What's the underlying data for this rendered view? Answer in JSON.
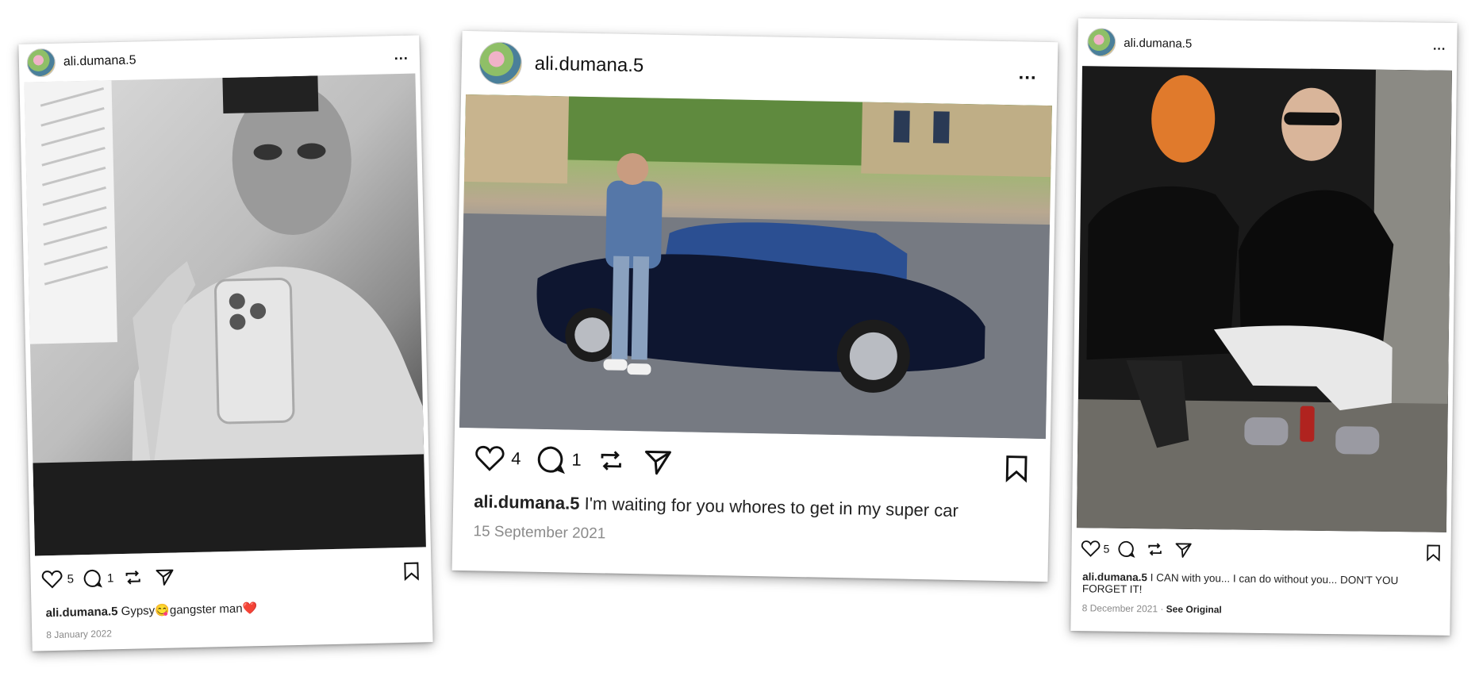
{
  "posts": [
    {
      "username": "ali.dumana.5",
      "more": "...",
      "likes": "5",
      "comments": "1",
      "caption_user": "ali.dumana.5",
      "caption_text": "Gypsy",
      "caption_emoji1": "😋",
      "caption_text2": "gangster man",
      "caption_emoji2": "❤️",
      "date": "8 January 2022"
    },
    {
      "username": "ali.dumana.5",
      "more": "...",
      "likes": "4",
      "comments": "1",
      "caption_user": "ali.dumana.5",
      "caption_text": "I'm waiting for you whores to get in my super car",
      "date": "15 September 2021"
    },
    {
      "username": "ali.dumana.5",
      "more": "...",
      "likes": "5",
      "comments": "",
      "caption_user": "ali.dumana.5",
      "caption_text": "I CAN with you... I can do without you... DON'T YOU FORGET IT!",
      "date": "8 December 2021",
      "separator": "·",
      "see_original": "See Original"
    }
  ],
  "colors": {
    "text": "#111111",
    "date": "#8a8a8a"
  }
}
